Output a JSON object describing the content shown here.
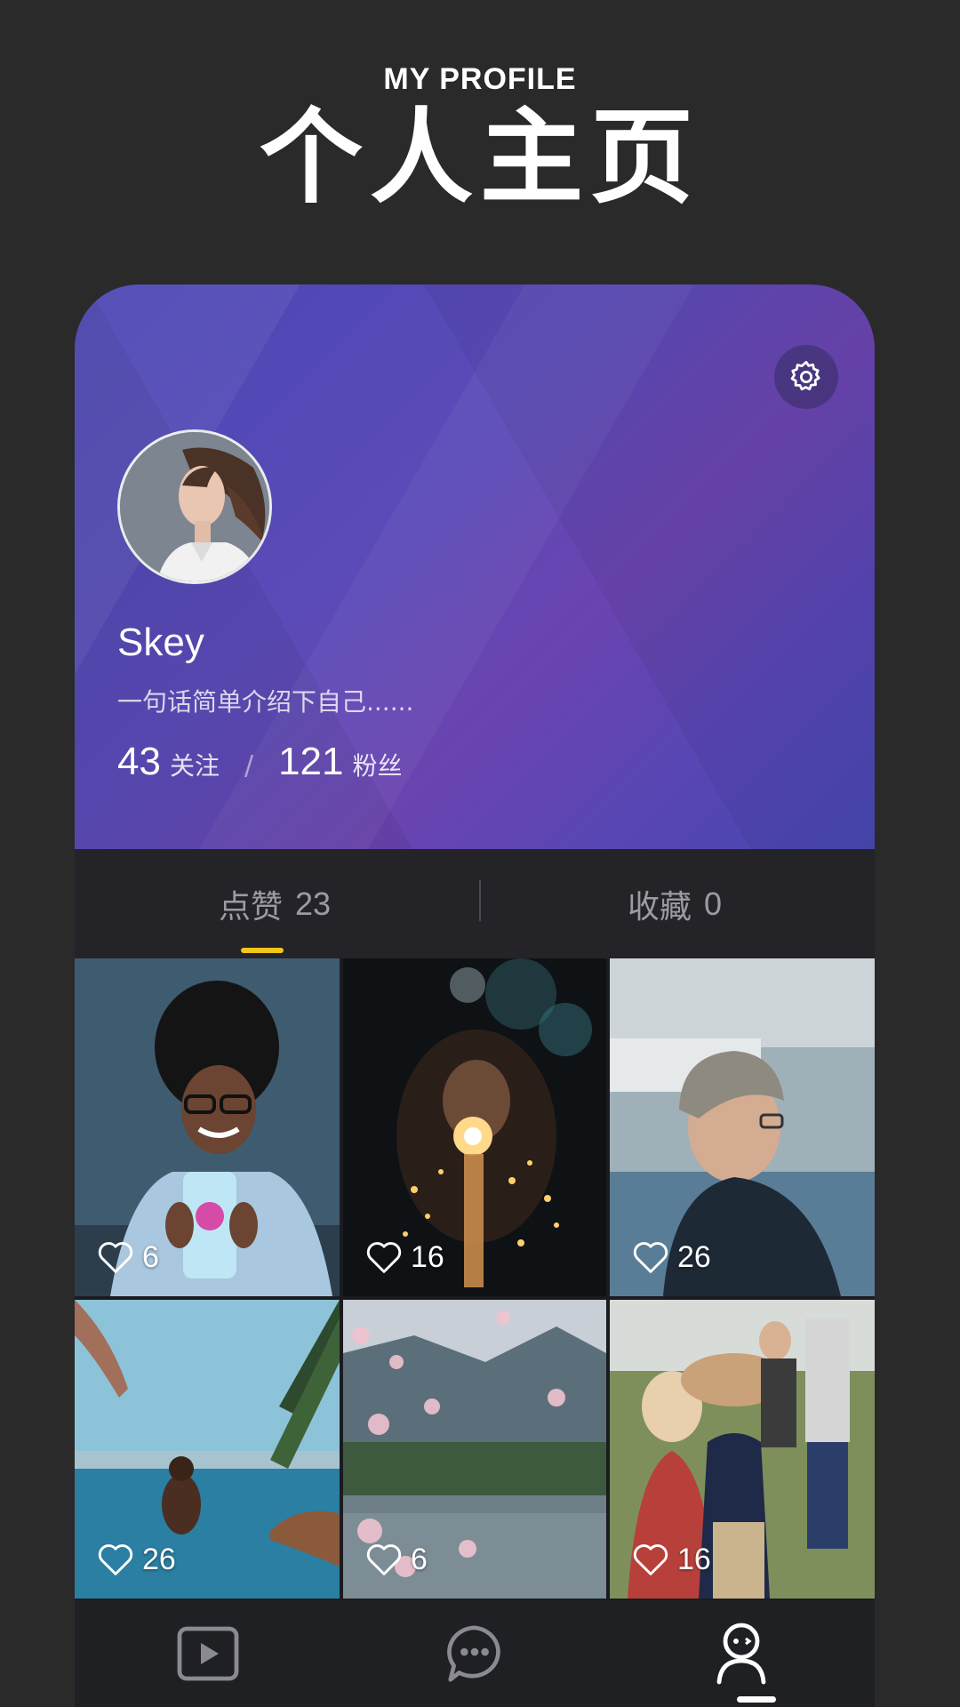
{
  "header": {
    "title_en": "MY PROFILE",
    "title_cn": "个人主页"
  },
  "profile": {
    "username": "Skey",
    "bio": "一句话简单介绍下自己......",
    "following_count": "43",
    "following_label": "关注",
    "separator": "/",
    "followers_count": "121",
    "followers_label": "粉丝"
  },
  "tabs": [
    {
      "label": "点赞",
      "count": "23",
      "active": true
    },
    {
      "label": "收藏",
      "count": "0",
      "active": false
    }
  ],
  "photos": [
    {
      "likes": "6",
      "subject": "woman-with-phone"
    },
    {
      "likes": "16",
      "subject": "sparkler"
    },
    {
      "likes": "26",
      "subject": "man-with-beanie"
    },
    {
      "likes": "26",
      "subject": "pool-palm"
    },
    {
      "likes": "6",
      "subject": "cherry-blossom-lake"
    },
    {
      "likes": "16",
      "subject": "family-field"
    }
  ],
  "nav": [
    {
      "icon": "play-icon",
      "active": false
    },
    {
      "icon": "chat-icon",
      "active": false
    },
    {
      "icon": "profile-icon",
      "active": true
    }
  ],
  "colors": {
    "background": "#2a2a2b",
    "accent": "#f5c518",
    "hero_start": "#4a46b4",
    "hero_end": "#6a44b0"
  }
}
